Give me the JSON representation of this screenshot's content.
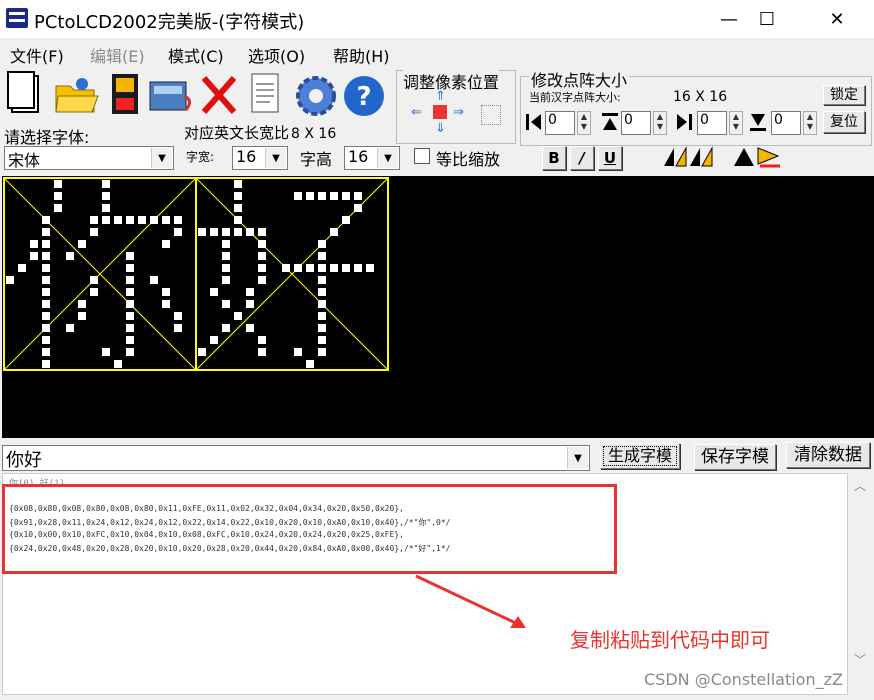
{
  "window": {
    "title": "PCtoLCD2002完美版-(字符模式)",
    "minimize_glyph": "—",
    "maximize_glyph": "☐",
    "close_glyph": "✕"
  },
  "menu": [
    "文件(F)",
    "编辑(E)",
    "模式(C)",
    "选项(O)",
    "帮助(H)"
  ],
  "toolbar_icons": [
    "new-file-icon",
    "open-folder-icon",
    "save-disk-icon",
    "scan-icon",
    "delete-x-icon",
    "notepad-icon",
    "settings-gear-icon",
    "help-question-icon"
  ],
  "adjust": {
    "title": "调整像素位置"
  },
  "resize": {
    "title": "修改点阵大小",
    "current_label": "当前汉字点阵大小:",
    "current_value": "16 X 16",
    "lock_button": "锁定",
    "reset_button": "复位",
    "spin_values": [
      "0",
      "0",
      "0",
      "0"
    ]
  },
  "font": {
    "select_label": "请选择字体:",
    "ratio_label": "对应英文长宽比",
    "ratio_value": "8 X 16",
    "font_name": "宋体",
    "width_label": "字宽:",
    "width_value": "16",
    "height_label": "字高",
    "height_value": "16",
    "scale_label": "等比缩放",
    "bold": "B",
    "italic": "/",
    "underline": "U"
  },
  "input": {
    "text": "你好",
    "generate_button": "生成字模",
    "save_button": "保存字模",
    "clear_button": "清除数据"
  },
  "output_lines": [
    "你(0) 好(1)",
    "{0x08,0x80,0x08,0x80,0x08,0x80,0x11,0xFE,0x11,0x02,0x32,0x04,0x34,0x20,0x50,0x20},",
    "{0x91,0x28,0x11,0x24,0x12,0x24,0x12,0x22,0x14,0x22,0x10,0x20,0x10,0xA0,0x10,0x40},/*\"你\",0*/",
    "{0x10,0x00,0x10,0xFC,0x10,0x04,0x10,0x08,0xFC,0x10,0x24,0x20,0x24,0x20,0x25,0xFE},",
    "{0x24,0x20,0x48,0x20,0x28,0x20,0x10,0x20,0x28,0x20,0x44,0x20,0x84,0xA0,0x00,0x40},/*\"好\",1*/"
  ],
  "annotation": "复制粘贴到代码中即可",
  "watermark": "CSDN @Constellation_zZ",
  "glyphs": [
    {
      "char": "你",
      "rows": [
        "0x08,0x80",
        "0x08,0x80",
        "0x08,0x80",
        "0x11,0xFE",
        "0x11,0x02",
        "0x32,0x04",
        "0x34,0x20",
        "0x50,0x20",
        "0x91,0x28",
        "0x11,0x24",
        "0x12,0x24",
        "0x12,0x22",
        "0x14,0x22",
        "0x10,0x20",
        "0x10,0xA0",
        "0x10,0x40"
      ]
    },
    {
      "char": "好",
      "rows": [
        "0x10,0x00",
        "0x10,0xFC",
        "0x10,0x04",
        "0x10,0x08",
        "0xFC,0x10",
        "0x24,0x20",
        "0x24,0x20",
        "0x25,0xFE",
        "0x24,0x20",
        "0x48,0x20",
        "0x28,0x20",
        "0x10,0x20",
        "0x28,0x20",
        "0x44,0x20",
        "0x84,0xA0",
        "0x00,0x40"
      ]
    }
  ],
  "colors": {
    "grid_frame": "#ffff00",
    "pixel": "#ffffff",
    "annotation": "#e8342f"
  }
}
